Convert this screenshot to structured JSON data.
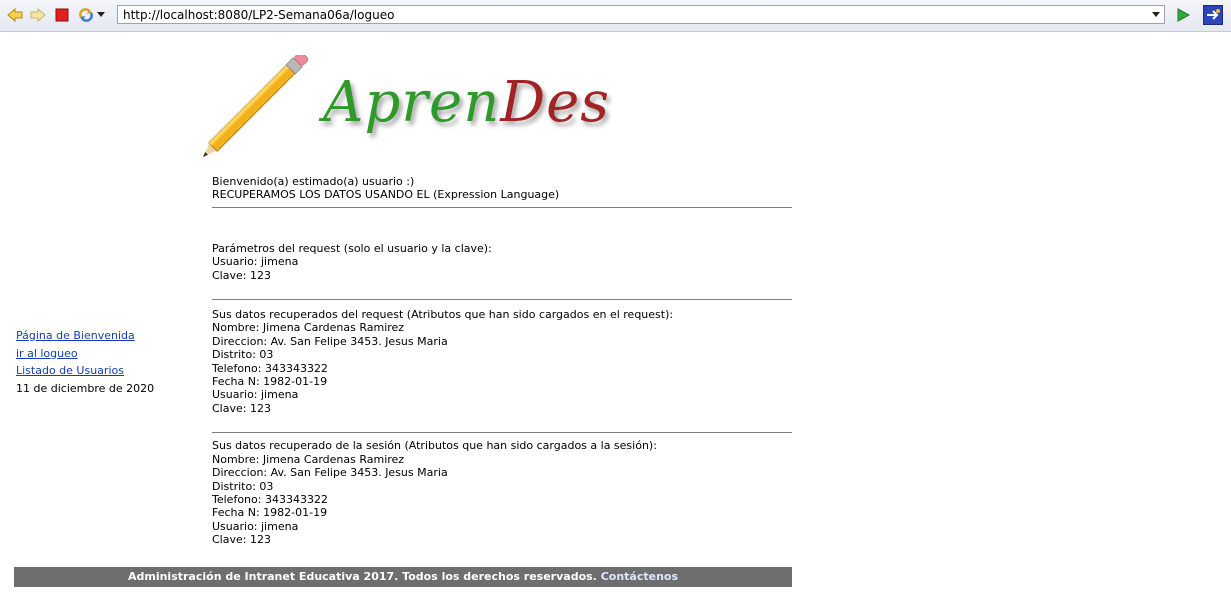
{
  "browser": {
    "url": "http://localhost:8080/LP2-Semana06a/logueo"
  },
  "logo": {
    "part1": "Apren",
    "part2": "Des",
    "color1": "#2f9a2a",
    "color2": "#a02424"
  },
  "welcome": {
    "line1": "Bienvenido(a) estimado(a) usuario :)",
    "line2": "RECUPERAMOS LOS DATOS USANDO EL (Expression Language)"
  },
  "request_params": {
    "title": "Parámetros del request (solo el usuario y la clave):",
    "usuario": "Usuario: jimena",
    "clave": "Clave: 123"
  },
  "request_data": {
    "title": "Sus datos recuperados del request (Atributos que han sido cargados en el request):",
    "nombre": "Nombre: Jimena Cardenas Ramirez",
    "direccion": "Direccion: Av. San Felipe 3453. Jesus Maria",
    "distrito": "Distrito: 03",
    "telefono": "Telefono: 343343322",
    "fecha": "Fecha N: 1982-01-19",
    "usuario": "Usuario: jimena",
    "clave": "Clave: 123"
  },
  "session_data": {
    "title": "Sus datos recuperado de la sesión (Atributos que han sido cargados a la sesión):",
    "nombre": "Nombre: Jimena Cardenas Ramirez",
    "direccion": "Direccion: Av. San Felipe 3453. Jesus Maria",
    "distrito": "Distrito: 03",
    "telefono": "Telefono: 343343322",
    "fecha": "Fecha N: 1982-01-19",
    "usuario": "Usuario: jimena",
    "clave": "Clave: 123"
  },
  "sidebar": {
    "links": [
      "Página de Bienvenida",
      "ir al logueo",
      "Listado de Usuarios"
    ],
    "date": "11 de diciembre de 2020"
  },
  "footer": {
    "text": "Administración de Intranet Educativa 2017. Todos los derechos reservados. ",
    "contact": "Contáctenos"
  }
}
